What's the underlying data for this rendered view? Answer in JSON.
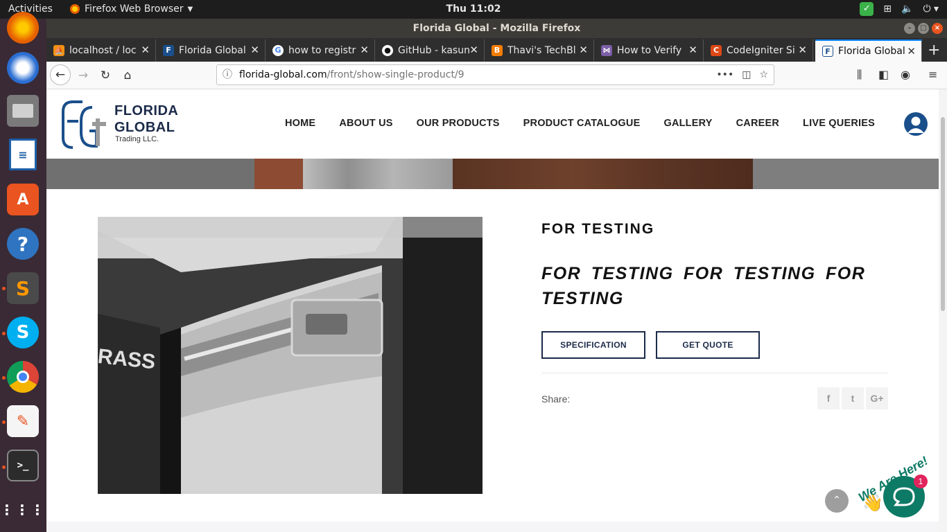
{
  "system": {
    "activities": "Activities",
    "app_menu": "Firefox Web Browser",
    "clock": "Thu 11:02"
  },
  "window": {
    "title": "Florida Global - Mozilla Firefox"
  },
  "tabs": [
    {
      "title": "localhost / loc",
      "favicon": "phpmyadmin-icon",
      "color": "#f29111"
    },
    {
      "title": "Florida Global",
      "favicon": "fgt-icon",
      "color": "#1a4f8b"
    },
    {
      "title": "how to registr",
      "favicon": "google-icon",
      "color": "#4285f4"
    },
    {
      "title": "GitHub - kasun",
      "favicon": "github-icon",
      "color": "#111111"
    },
    {
      "title": "Thavi's TechBl",
      "favicon": "blogger-icon",
      "color": "#f57d00"
    },
    {
      "title": "How to Verify",
      "favicon": "link-icon",
      "color": "#7b5ea7"
    },
    {
      "title": "CodeIgniter Si",
      "favicon": "codeigniter-icon",
      "color": "#dd4814"
    },
    {
      "title": "Florida Global",
      "favicon": "fgt-icon",
      "color": "#1a4f8b",
      "active": true
    }
  ],
  "url": {
    "domain": "florida-global.com",
    "path": "/front/show-single-product/9"
  },
  "site": {
    "logo": {
      "line1": "FLORIDA",
      "line2": "GLOBAL",
      "line3": "Trading LLC."
    },
    "nav": [
      "HOME",
      "ABOUT US",
      "OUR PRODUCTS",
      "PRODUCT CATALOGUE",
      "GALLERY",
      "CAREER",
      "LIVE QUERIES"
    ]
  },
  "product": {
    "title": "FOR TESTING",
    "description": "FOR TESTING  FOR TESTING  FOR TESTING",
    "specification_button": "SPECIFICATION",
    "quote_button": "GET QUOTE",
    "share_label": "Share:",
    "social": [
      {
        "name": "facebook",
        "glyph": "f"
      },
      {
        "name": "twitter",
        "glyph": "t"
      },
      {
        "name": "google-plus",
        "glyph": "G+"
      }
    ],
    "image_text": "RASS"
  },
  "chat": {
    "label": "We Are Here!",
    "badge": "1"
  },
  "colors": {
    "brand_navy": "#1c2b4a",
    "chat_green": "#0d7a66",
    "firefox_accent": "#0a84ff"
  }
}
